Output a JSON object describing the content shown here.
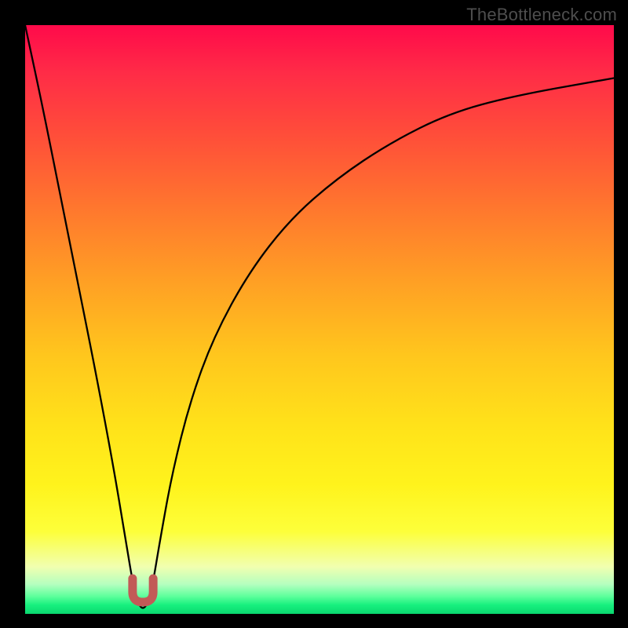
{
  "watermark": "TheBottleneck.com",
  "chart_data": {
    "type": "line",
    "title": "",
    "xlabel": "",
    "ylabel": "",
    "xlim": [
      0,
      100
    ],
    "ylim": [
      0,
      100
    ],
    "grid": false,
    "legend": false,
    "background_gradient": {
      "direction": "vertical",
      "stops": [
        {
          "pos": 0,
          "color": "#ff0a4a"
        },
        {
          "pos": 20,
          "color": "#ff5238"
        },
        {
          "pos": 44,
          "color": "#ffa124"
        },
        {
          "pos": 68,
          "color": "#ffe21a"
        },
        {
          "pos": 86,
          "color": "#fdff3a"
        },
        {
          "pos": 95,
          "color": "#b4ffbf"
        },
        {
          "pos": 100,
          "color": "#0ad86f"
        }
      ]
    },
    "series": [
      {
        "name": "bottleneck-curve",
        "color": "#000000",
        "x": [
          0,
          3,
          6,
          9,
          12,
          15,
          17,
          18.5,
          19.5,
          20.5,
          21.5,
          23,
          25,
          28,
          32,
          38,
          45,
          53,
          62,
          72,
          83,
          100
        ],
        "y": [
          100,
          86,
          71,
          56,
          41,
          25,
          13,
          4,
          1,
          1,
          4,
          13,
          24,
          36,
          47,
          58,
          67,
          74,
          80,
          85,
          88,
          91
        ]
      }
    ],
    "marker": {
      "name": "dip-marker",
      "color": "#c25a57",
      "shape": "u",
      "x": 20,
      "y": 2,
      "width_x": 3.5,
      "height_y": 4
    }
  }
}
